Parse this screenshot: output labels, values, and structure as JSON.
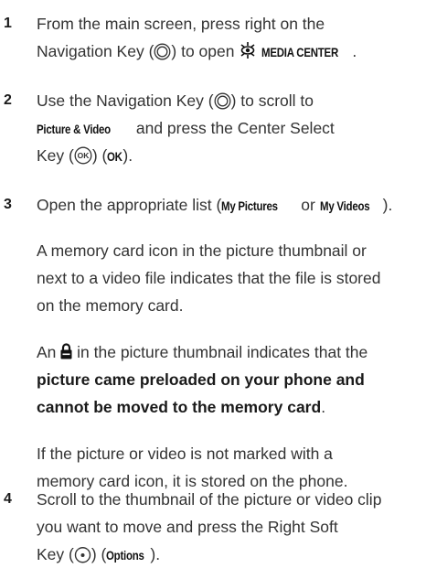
{
  "steps": [
    {
      "number": "1",
      "lines": [
        {
          "pre": "From the main screen, press right on the"
        },
        {
          "pre": "Navigation Key (",
          "icon1": "nav-key-icon",
          "mid": ") to open ",
          "icon2": "media-center-icon",
          "kw": "MEDIA CENTER",
          "post": "."
        }
      ]
    },
    {
      "number": "2",
      "lines": [
        {
          "pre": "Use the Navigation Key (",
          "icon1": "nav-key-icon",
          "post": ") to scroll to"
        },
        {
          "kw": "Picture & Video",
          "post": " and press the Center Select"
        },
        {
          "pre": "Key (",
          "icon1": "ok-key-icon",
          "mid": ") (",
          "kw": "OK",
          "post": ")."
        }
      ]
    },
    {
      "number": "3",
      "lines": [
        {
          "pre": "Open the appropriate list (",
          "kw": "My Pictures",
          "mid": " or ",
          "kw2": "My Videos",
          "post": ")."
        }
      ],
      "para1": [
        "A memory card icon in the picture thumbnail or",
        "next to a video file indicates that the file is stored",
        "on the memory card."
      ],
      "para2_line1_pre": "An ",
      "para2_line1_post": " in the picture thumbnail indicates that the",
      "para2_bold": [
        "picture came preloaded on your phone and",
        "cannot be moved to the memory card"
      ],
      "para2_end": ".",
      "para3": [
        "If the picture or video is not marked with a",
        "memory card icon, it is stored on the phone."
      ]
    },
    {
      "number": "4",
      "lines": [
        {
          "pre": "Scroll to the thumbnail of the picture or video clip"
        },
        {
          "pre": "you want to move and press the Right Soft"
        },
        {
          "pre": "Key (",
          "icon1": "right-soft-key-icon",
          "mid": ") (",
          "kw": "Options",
          "post": ")."
        }
      ]
    }
  ]
}
